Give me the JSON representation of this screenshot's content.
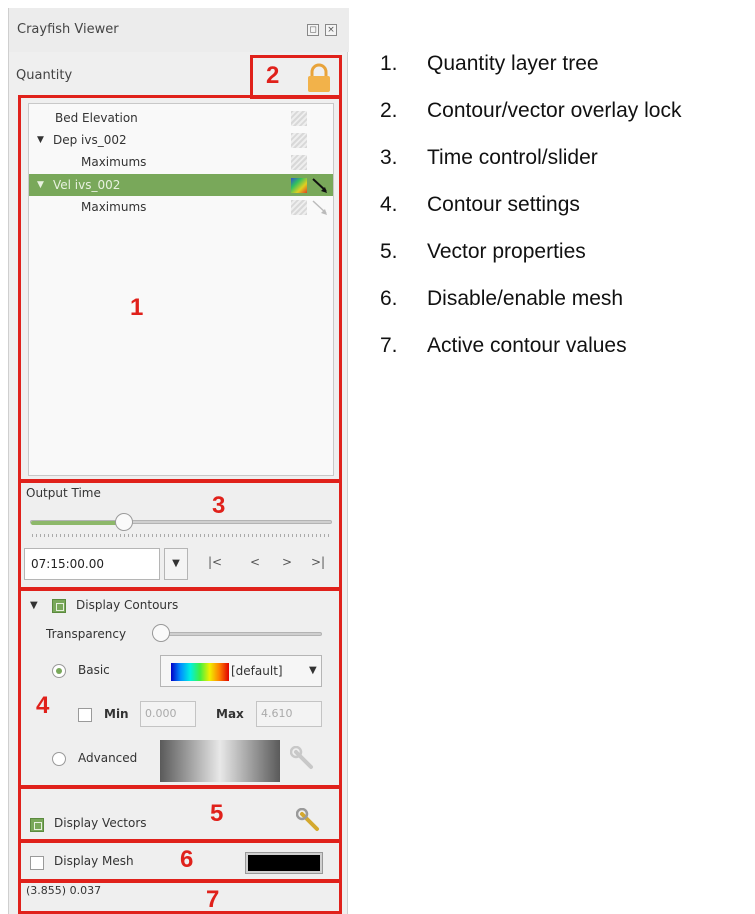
{
  "window": {
    "title": "Crayfish Viewer",
    "float_icon": "float-icon",
    "close_icon": "close-icon"
  },
  "quantity": {
    "label": "Quantity",
    "lock_icon": "lock-icon",
    "tree": [
      {
        "label": "Bed Elevation",
        "expanded": null,
        "selected": false
      },
      {
        "label": "Dep  ivs_002",
        "expanded": true,
        "selected": false
      },
      {
        "label": "Maximums",
        "expanded": null,
        "selected": false
      },
      {
        "label": "Vel  ivs_002",
        "expanded": true,
        "selected": true
      },
      {
        "label": "Maximums",
        "expanded": null,
        "selected": false
      }
    ]
  },
  "output_time": {
    "label": "Output Time",
    "value": "07:15:00.00",
    "nav": {
      "first": "|<",
      "prev": "<",
      "next": ">",
      "last": ">|"
    },
    "slider_fraction": 0.3
  },
  "contours": {
    "label": "Display Contours",
    "checked": true,
    "transparency_label": "Transparency",
    "transparency_fraction": 0.0,
    "basic_label": "Basic",
    "basic_selected": true,
    "ramp_name": "[default]",
    "min_label": "Min",
    "min_value": "0.000",
    "max_label": "Max",
    "max_value": "4.610",
    "advanced_label": "Advanced"
  },
  "vectors": {
    "label": "Display Vectors",
    "checked": true
  },
  "mesh": {
    "label": "Display Mesh",
    "checked": false,
    "color": "#000000"
  },
  "status": {
    "value_text": "(3.855) 0.037"
  },
  "callouts": [
    "1",
    "2",
    "3",
    "4",
    "5",
    "6",
    "7"
  ],
  "legend": [
    {
      "num": "1.",
      "text": "Quantity layer tree"
    },
    {
      "num": "2.",
      "text": "Contour/vector overlay lock"
    },
    {
      "num": "3.",
      "text": "Time control/slider"
    },
    {
      "num": "4.",
      "text": "Contour settings"
    },
    {
      "num": "5.",
      "text": "Vector properties"
    },
    {
      "num": "6.",
      "text": "Disable/enable mesh"
    },
    {
      "num": "7.",
      "text": "Active contour values"
    }
  ],
  "colors": {
    "annotation_red": "#e0211b",
    "selection_green": "#79a85a"
  }
}
